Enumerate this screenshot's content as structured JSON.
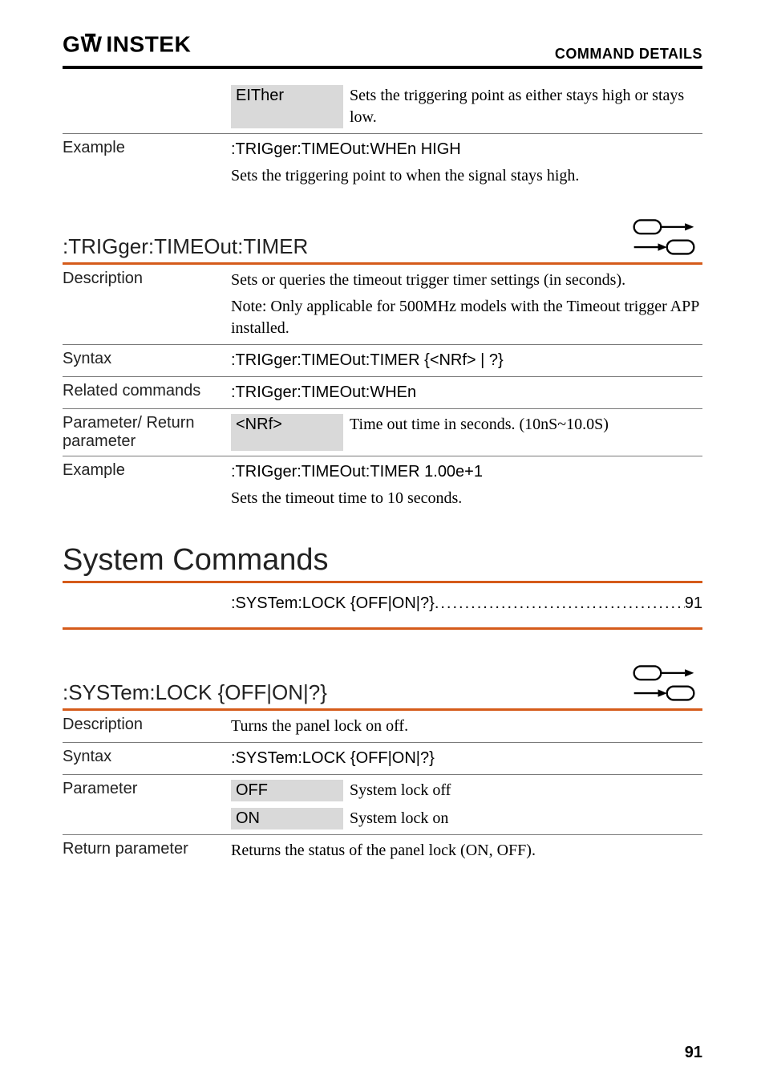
{
  "header": {
    "brand_svg_title": "GWINSTEK",
    "right": "COMMAND DETAILS"
  },
  "either_row": {
    "param": "EITher",
    "desc": "Sets the triggering point as either stays high or stays low."
  },
  "example1": {
    "label": "Example",
    "cmd": ":TRIGger:TIMEOut:WHEn HIGH",
    "desc": "Sets the triggering point to when the signal stays high."
  },
  "section1": {
    "heading": ":TRIGger:TIMEOut:TIMER",
    "description_label": "Description",
    "description_body": "Sets or queries the timeout trigger timer settings (in seconds).",
    "description_note": "Note: Only applicable for 500MHz models with the Timeout trigger APP installed.",
    "syntax_label": "Syntax",
    "syntax_body": ":TRIGger:TIMEOut:TIMER {<NRf> | ?}",
    "related_label": "Related commands",
    "related_body": ":TRIGger:TIMEOut:WHEn",
    "param_label": "Parameter/ Return parameter",
    "param_cell": "<NRf>",
    "param_desc": "Time out time in seconds. (10nS~10.0S)",
    "example_label": "Example",
    "example_cmd": ":TRIGger:TIMEOut:TIMER 1.00e+1",
    "example_desc": "Sets the timeout time to 10 seconds."
  },
  "system": {
    "heading": "System Commands",
    "toc_label": ":SYSTem:LOCK {OFF|ON|?}",
    "toc_page": "91"
  },
  "section2": {
    "heading": ":SYSTem:LOCK {OFF|ON|?}",
    "description_label": "Description",
    "description_body": "Turns the panel lock on off.",
    "syntax_label": "Syntax",
    "syntax_body": ":SYSTem:LOCK {OFF|ON|?}",
    "parameter_label": "Parameter",
    "p_off": "OFF",
    "p_off_desc": "System lock off",
    "p_on": "ON",
    "p_on_desc": "System lock on",
    "return_label": "Return parameter",
    "return_body": "Returns the status of the panel lock (ON, OFF)."
  },
  "page_number": "91"
}
